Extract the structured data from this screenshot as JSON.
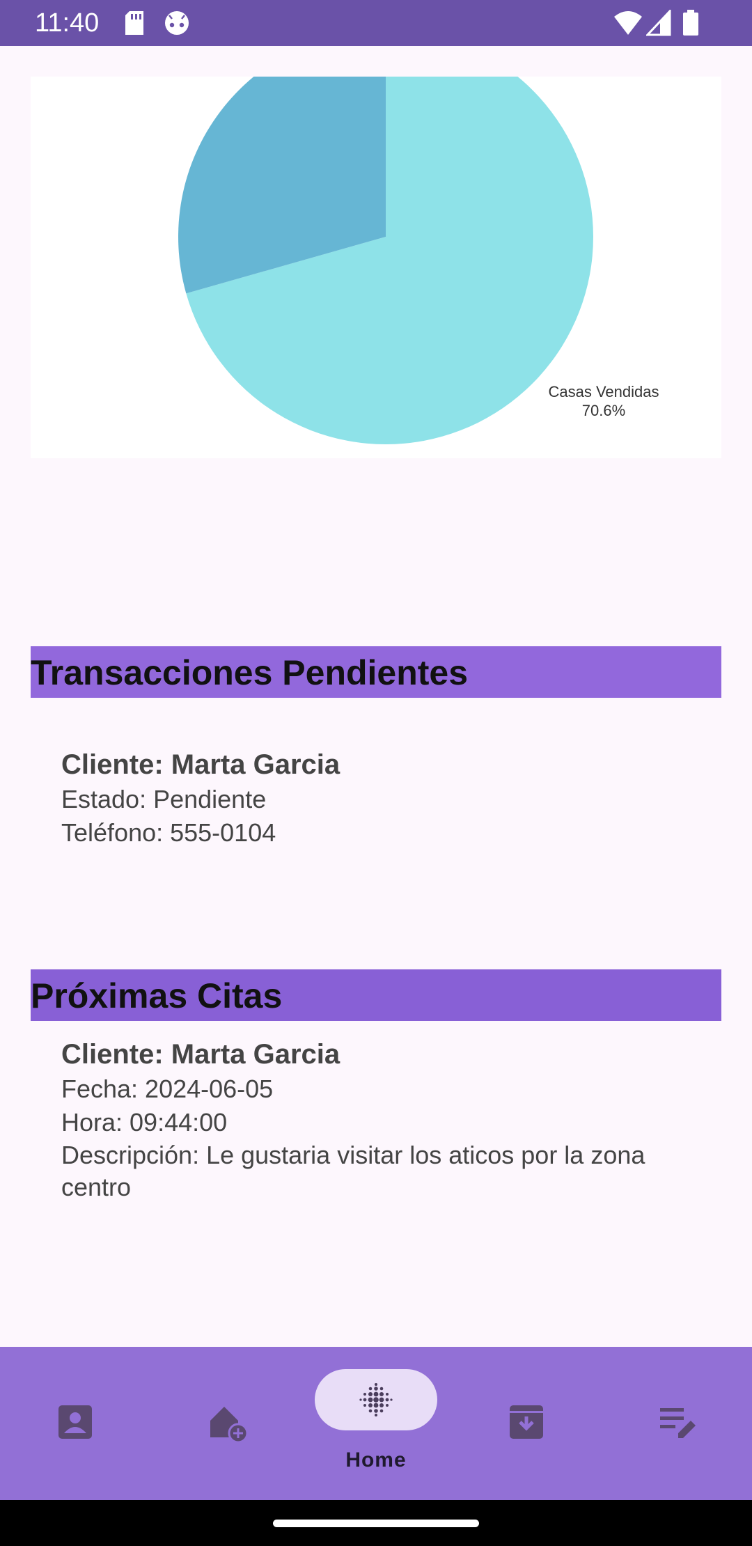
{
  "status_bar": {
    "time": "11:40",
    "left_icons": [
      "sd-card-icon",
      "android-icon"
    ],
    "right_icons": [
      "wifi-icon",
      "signal-icon",
      "battery-icon"
    ]
  },
  "chart_data": {
    "type": "pie",
    "slices": [
      {
        "label": "Casas Vendidas",
        "value": 70.6,
        "color": "#8ee2e8",
        "label_text": "Casas Vendidas",
        "percent_text": "70.6%"
      },
      {
        "label": "",
        "value": 29.4,
        "color": "#66b6d4"
      }
    ]
  },
  "transacciones": {
    "title": "Transacciones Pendientes",
    "client": "Cliente: Marta Garcia",
    "estado": "Estado: Pendiente",
    "telefono": "Teléfono: 555-0104"
  },
  "citas": {
    "title": "Próximas Citas",
    "client": "Cliente: Marta Garcia",
    "fecha": "Fecha: 2024-06-05",
    "hora": "Hora: 09:44:00",
    "descripcion": "Descripción: Le gustaria visitar los aticos por la zona centro"
  },
  "bottom_nav": {
    "items": [
      {
        "icon": "contact-icon"
      },
      {
        "icon": "add-home-icon"
      },
      {
        "icon": "home-grid-icon",
        "label": "Home",
        "active": true
      },
      {
        "icon": "archive-download-icon"
      },
      {
        "icon": "edit-list-icon"
      }
    ]
  },
  "colors": {
    "status_bar": "#6a52a8",
    "section_header": "#9268dc",
    "bottom_nav": "#9270d6",
    "active_pill": "#e8ddf7"
  }
}
